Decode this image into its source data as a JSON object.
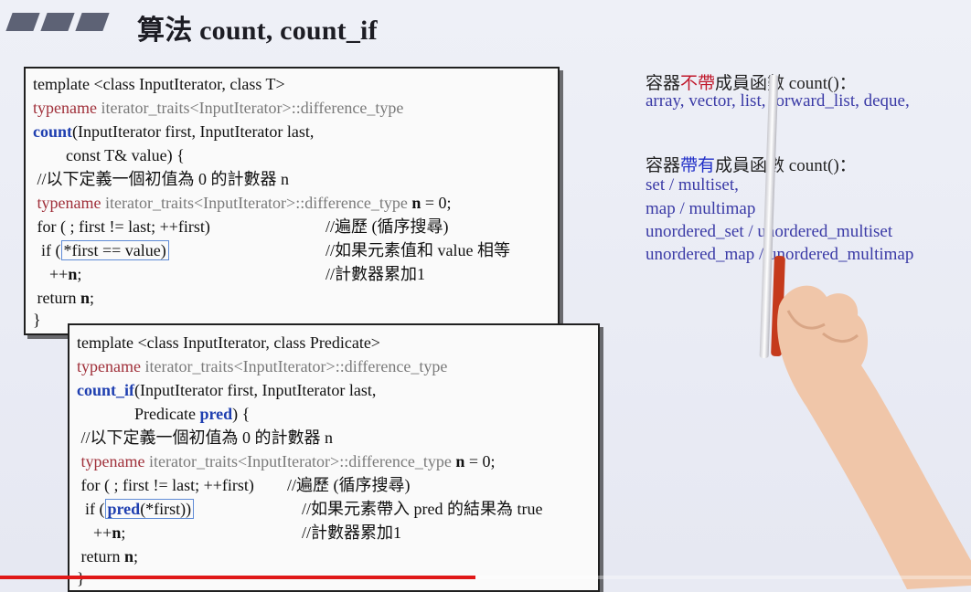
{
  "title": "算法 count, count_if",
  "box1": {
    "l1": "template <class InputIterator, class T>",
    "l2a": "typename",
    "l2b": " iterator_traits<InputIterator>::difference_type",
    "l3a": "count",
    "l3b": "(InputIterator first, InputIterator last,",
    "l4": "        const T& value) {",
    "l5": " //以下定義一個初值為 0 的計數器 n",
    "l6a": " typename",
    "l6b": " iterator_traits<InputIterator>::difference_type",
    "l6c": " n",
    "l6d": " = 0;",
    "l7a": " for ( ; first != last; ++first)",
    "l7b": "//遍歷 (循序搜尋)",
    "l8a": "  if (",
    "l8b": "*first == value)",
    "l8c": "//如果元素值和 value 相等",
    "l9a": "    ++",
    "l9b": "n",
    "l9c": ";",
    "l9d": "//計數器累加1",
    "l10a": " return ",
    "l10b": "n",
    "l10c": ";",
    "l11": "}"
  },
  "box2": {
    "l1": "template <class InputIterator, class Predicate>",
    "l2a": "typename",
    "l2b": " iterator_traits<InputIterator>::difference_type",
    "l3a": "count_if",
    "l3b": "(InputIterator first, InputIterator last,",
    "l4a": "              Predicate ",
    "l4b": "pred",
    "l4c": ") {",
    "l5": " //以下定義一個初值為 0 的計數器 n",
    "l6a": " typename",
    "l6b": " iterator_traits<InputIterator>::difference_type",
    "l6c": " n",
    "l6d": " = 0;",
    "l7a": " for ( ; first != last; ++first)",
    "l7b": "//遍歷 (循序搜尋)",
    "l8a": "  if (",
    "l8b": "pred",
    "l8c": "(*first))",
    "l8d": "//如果元素帶入 pred 的結果為 true",
    "l9a": "    ++",
    "l9b": "n",
    "l9c": ";",
    "l9d": "//計數器累加1",
    "l10a": " return ",
    "l10b": "n",
    "l10c": ";",
    "l11": "}"
  },
  "right": {
    "h1a": "容器",
    "h1b": "不帶",
    "h1c": "成員函數 count()：",
    "h1list": "array, vector, list, forward_list, deque,",
    "h2a": "容器",
    "h2b": "帶有",
    "h2c": "成員函數 count()：",
    "items": [
      "set / multiset,",
      "map / multimap",
      "unordered_set / unordered_multiset",
      "unordered_map / unordered_multimap"
    ]
  },
  "colors": {
    "typename": "#a0303a",
    "keyword_blue": "#1f3fb0",
    "red_emphasis": "#c0192c",
    "progress": "#e01818"
  },
  "video_progress": 0.49
}
